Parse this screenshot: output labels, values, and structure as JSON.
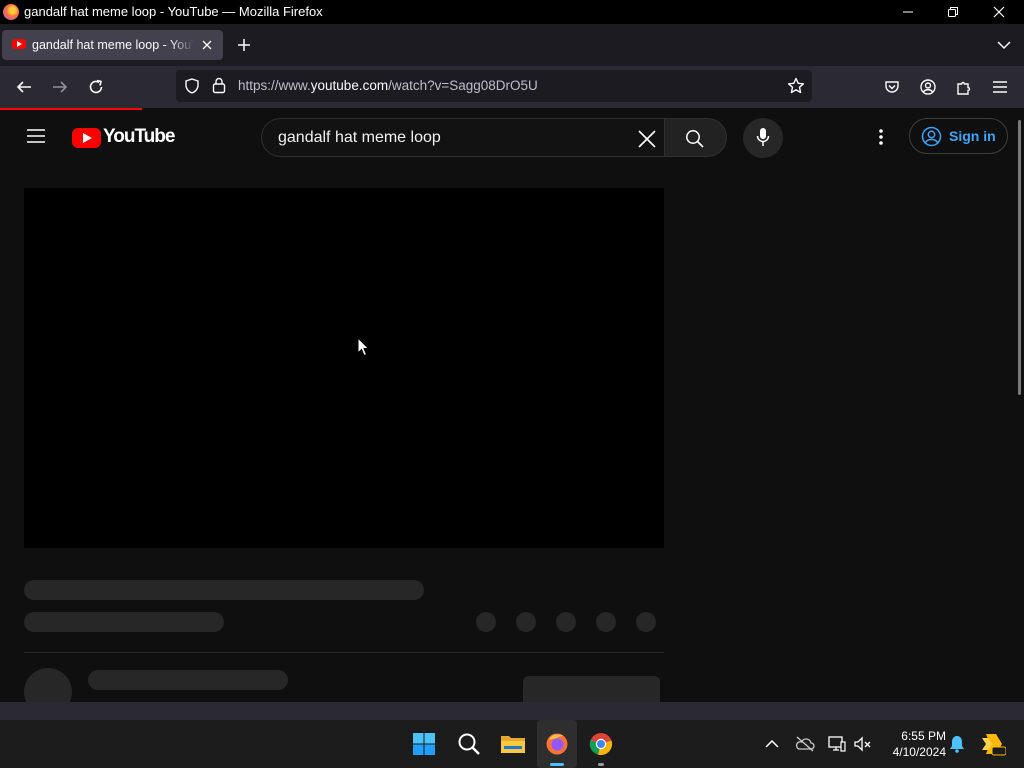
{
  "window": {
    "title": "gandalf hat meme loop - YouTube — Mozilla Firefox"
  },
  "tab": {
    "title": "gandalf hat meme loop - YouTube"
  },
  "navbar": {
    "url_prefix": "https://www.",
    "url_domain": "youtube.com",
    "url_path": "/watch?v=Sagg08DrO5U"
  },
  "youtube": {
    "logo_text": "YouTube",
    "search_query": "gandalf hat meme loop",
    "signin_label": "Sign in",
    "accent_color": "#ff0000",
    "link_color": "#3ea6ff"
  },
  "taskbar": {
    "time": "6:55 PM",
    "date": "4/10/2024",
    "apps": [
      "start-icon",
      "search-icon",
      "file-explorer-icon",
      "firefox-icon",
      "chrome-icon"
    ]
  }
}
